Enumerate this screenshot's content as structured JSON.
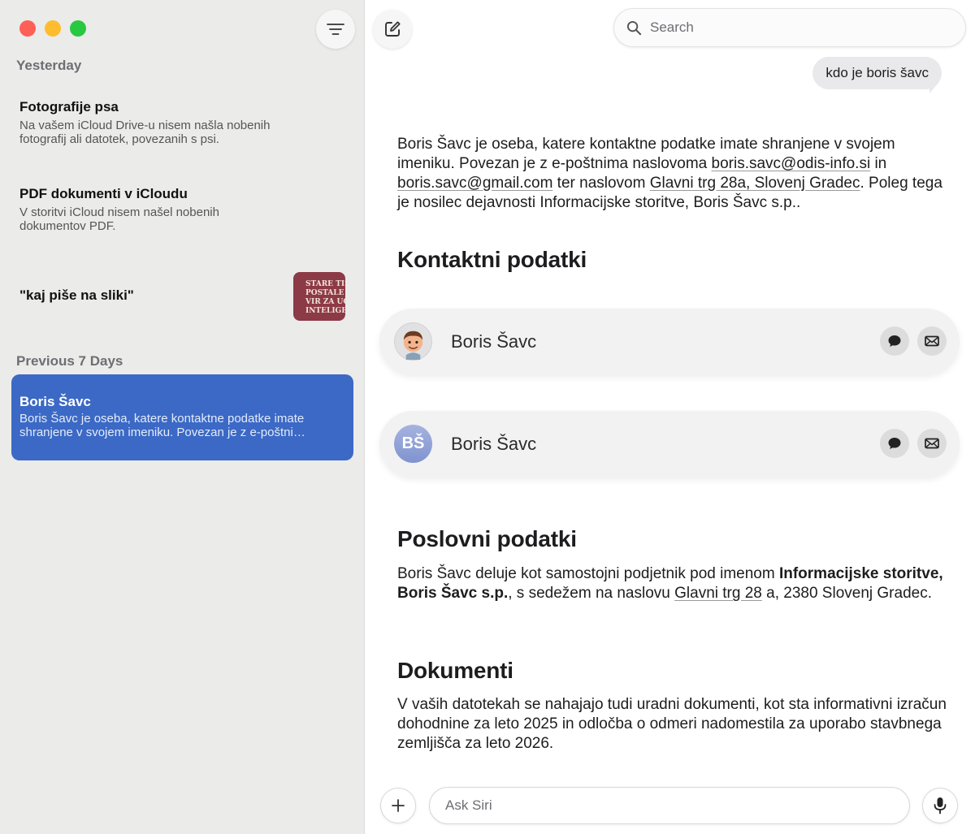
{
  "sidebar": {
    "sections": [
      {
        "header": "Yesterday",
        "items": [
          {
            "title": "Fotografije psa",
            "preview_line1": "Na vašem iCloud Drive-u nisem našla nobenih",
            "preview_line2": "fotografij ali datotek, povezanih s psi."
          },
          {
            "title": "PDF dokumenti v iCloudu",
            "preview_line1": "V storitvi iCloud nisem našel nobenih",
            "preview_line2": "dokumentov PDF."
          },
          {
            "title": "\"kaj piše na sliki\"",
            "thumbnail_text": [
              "STARE TIS",
              "POSTALE",
              "VIR ZA UČ",
              "INTELIGE"
            ]
          }
        ]
      },
      {
        "header": "Previous 7 Days",
        "items": [
          {
            "title": "Boris Šavc",
            "preview_line1": "Boris Šavc je oseba, katere kontaktne podatke imate",
            "preview_line2": "shranjene v svojem imeniku. Povezan je z e-poštni…",
            "selected": true
          }
        ]
      }
    ]
  },
  "header": {
    "search_placeholder": "Search"
  },
  "conversation": {
    "user_message": "kdo je boris šavc",
    "intro": {
      "t1": "Boris Šavc je oseba, katere kontaktne podatke imate shranjene v svojem imeniku. Povezan je z e-poštnima naslovoma ",
      "email1": "boris.savc@odis-info.si",
      "t2": " in ",
      "email2": "boris.savc@gmail.com",
      "t3": " ter naslovom ",
      "address": "Glavni trg 28a, Slovenj Gradec",
      "t4": ". Poleg tega je nosilec dejavnosti Informacijske storitve, Boris Šavc s.p.."
    },
    "contacts_heading": "Kontaktni podatki",
    "contacts": [
      {
        "name": "Boris Šavc",
        "avatar": "memoji"
      },
      {
        "name": "Boris Šavc",
        "avatar": "initials",
        "initials": "BŠ"
      }
    ],
    "business_heading": "Poslovni podatki",
    "business": {
      "t1": "Boris Šavc deluje kot samostojni podjetnik pod imenom ",
      "bold": "Informacijske storitve, Boris Šavc s.p.",
      "t2": ", s sedežem na naslovu ",
      "address": "Glavni trg 28",
      "t3": " a, 2380 Slovenj Gradec."
    },
    "documents_heading": "Dokumenti",
    "documents_text": "V vaših datotekah se nahajajo tudi uradni dokumenti, kot sta informativni izračun dohodnine za leto 2025 in odločba o odmeri nadomestila za uporabo stavbnega zemljišča za leto 2026."
  },
  "composer": {
    "placeholder": "Ask Siri"
  },
  "colors": {
    "selected": "#3b69c5",
    "close": "#fe5f57",
    "minimize": "#febc2e",
    "maximize": "#28c840"
  }
}
